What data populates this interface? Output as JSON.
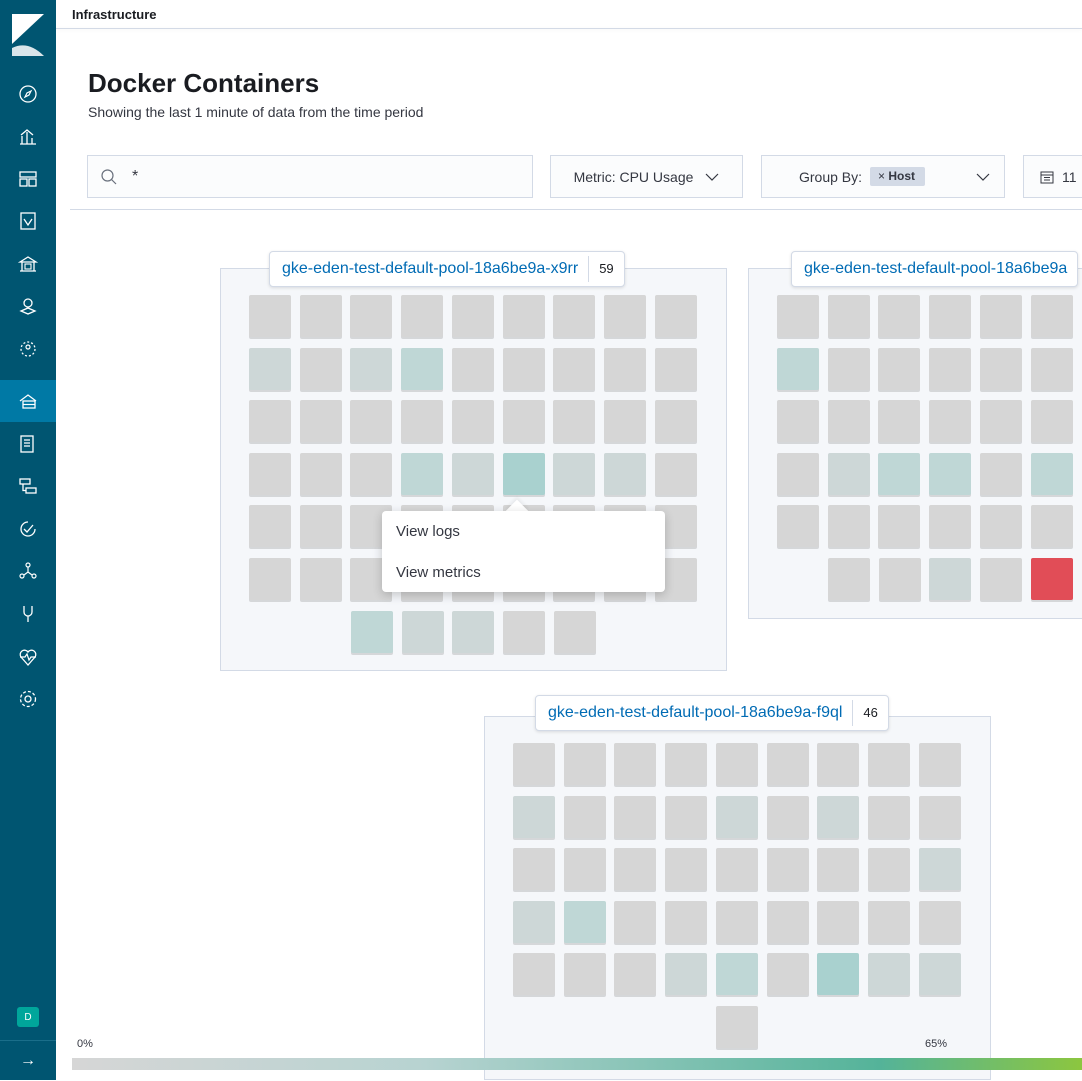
{
  "app": {
    "breadcrumb": "Infrastructure",
    "user_initial": "D"
  },
  "sidebar": {
    "items": [
      {
        "icon": "discover-icon"
      },
      {
        "icon": "visualize-icon"
      },
      {
        "icon": "dashboard-icon"
      },
      {
        "icon": "canvas-icon"
      },
      {
        "icon": "maps-icon"
      },
      {
        "icon": "ml-icon"
      },
      {
        "icon": "graph-icon"
      },
      {
        "icon": "infrastructure-icon",
        "active": true
      },
      {
        "icon": "logs-icon"
      },
      {
        "icon": "apm-icon"
      },
      {
        "icon": "uptime-icon"
      },
      {
        "icon": "siem-icon"
      },
      {
        "icon": "dev-tools-icon"
      },
      {
        "icon": "monitoring-icon"
      },
      {
        "icon": "management-icon"
      }
    ]
  },
  "header": {
    "title": "Docker Containers",
    "subtitle": "Showing the last 1 minute of data from the time period"
  },
  "toolbar": {
    "search_value": "*",
    "metric_label": "Metric: CPU Usage",
    "groupby_label": "Group By:",
    "groupby_pill": "Host",
    "groupby_pill_remove": "×",
    "date_value": "11"
  },
  "colors": {
    "sidebar": "#005571",
    "sidebar_active": "#0079a5",
    "node_grey": "#d6d6d6",
    "node_teal_light": "#cdd7d7",
    "node_teal": "#bfd7d6",
    "node_teal_dark": "#a9d1cf",
    "node_red": "#e14d57",
    "link": "#006bb4"
  },
  "groups": [
    {
      "name": "gke-eden-test-default-pool-18a6be9a-x9rr",
      "count": "59",
      "rows": [
        [
          0,
          0,
          0,
          0,
          0,
          0,
          0,
          0,
          0
        ],
        [
          1,
          0,
          1,
          2,
          0,
          0,
          0,
          0,
          0
        ],
        [
          0,
          0,
          0,
          0,
          0,
          0,
          0,
          0,
          0
        ],
        [
          0,
          0,
          0,
          2,
          1,
          3,
          1,
          1,
          0
        ],
        [
          0,
          0,
          0,
          0,
          0,
          0,
          0,
          0,
          0
        ],
        [
          0,
          0,
          0,
          0,
          0,
          0,
          0,
          0,
          0
        ],
        [
          2,
          1,
          1,
          0,
          0
        ]
      ]
    },
    {
      "name": "gke-eden-test-default-pool-18a6be9a",
      "count": "",
      "rows": [
        [
          0,
          0,
          0,
          0,
          0,
          0
        ],
        [
          2,
          0,
          0,
          0,
          0,
          0
        ],
        [
          0,
          0,
          0,
          0,
          0,
          0
        ],
        [
          0,
          1,
          2,
          2,
          0,
          2
        ],
        [
          0,
          0,
          0,
          0,
          0,
          0
        ],
        [
          0,
          0,
          1,
          0,
          4,
          0
        ]
      ]
    },
    {
      "name": "gke-eden-test-default-pool-18a6be9a-f9ql",
      "count": "46",
      "rows": [
        [
          0,
          0,
          0,
          0,
          0,
          0,
          0,
          0,
          0
        ],
        [
          1,
          0,
          0,
          0,
          1,
          0,
          1,
          0,
          0
        ],
        [
          0,
          0,
          0,
          0,
          0,
          0,
          0,
          0,
          1
        ],
        [
          1,
          2,
          0,
          0,
          0,
          0,
          0,
          0,
          0
        ],
        [
          0,
          0,
          0,
          1,
          2,
          0,
          3,
          1,
          1
        ],
        [
          0
        ]
      ]
    }
  ],
  "popover": {
    "view_logs": "View logs",
    "view_metrics": "View metrics"
  },
  "legend": {
    "min": "0%",
    "max": "65%",
    "start_color": "#d6d6d6",
    "end_color": "#8cc63f"
  }
}
